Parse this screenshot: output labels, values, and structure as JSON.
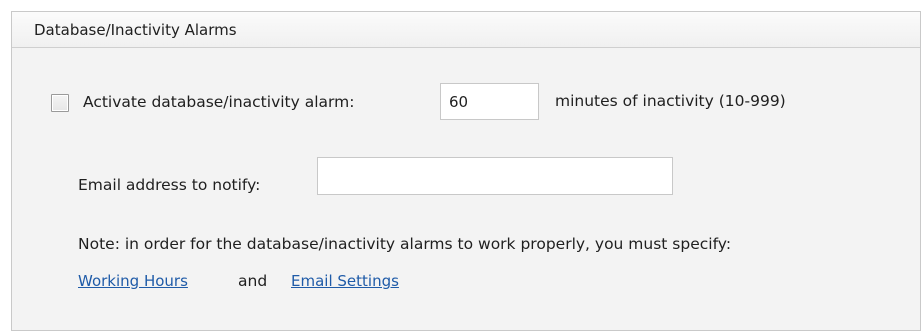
{
  "panel": {
    "title": "Database/Inactivity Alarms"
  },
  "activate": {
    "label": "Activate database/inactivity alarm:",
    "checked": false,
    "minutes_value": "60",
    "minutes_hint": "minutes of inactivity (10-999)"
  },
  "email": {
    "label": "Email address to notify:",
    "value": ""
  },
  "note": {
    "text": "Note: in order for the database/inactivity alarms to work properly, you must specify:",
    "working_hours_link": "Working Hours",
    "and_text": "and",
    "email_settings_link": "Email Settings"
  },
  "colors": {
    "link": "#1f5ba8",
    "panel_background": "#f3f3f3",
    "border": "#c9c9c9"
  }
}
